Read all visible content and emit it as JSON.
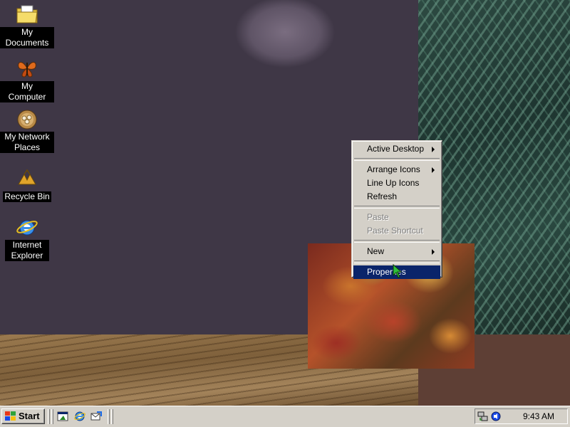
{
  "desktop": {
    "icons": [
      {
        "label": "My Documents",
        "icon": "folder-documents-icon"
      },
      {
        "label": "My Computer",
        "icon": "my-computer-butterfly-icon"
      },
      {
        "label": "My Network Places",
        "icon": "network-places-icon"
      },
      {
        "label": "Recycle Bin",
        "icon": "recycle-bin-icon"
      },
      {
        "label": "Internet Explorer",
        "icon": "internet-explorer-icon"
      }
    ]
  },
  "context_menu": {
    "items": [
      {
        "label": "Active Desktop",
        "submenu": true,
        "enabled": true
      },
      {
        "label": "Arrange Icons",
        "submenu": true,
        "enabled": true
      },
      {
        "label": "Line Up Icons",
        "submenu": false,
        "enabled": true
      },
      {
        "label": "Refresh",
        "submenu": false,
        "enabled": true
      },
      {
        "label": "Paste",
        "submenu": false,
        "enabled": false
      },
      {
        "label": "Paste Shortcut",
        "submenu": false,
        "enabled": false
      },
      {
        "label": "New",
        "submenu": true,
        "enabled": true
      },
      {
        "label": "Properties",
        "submenu": false,
        "enabled": true,
        "highlighted": true
      }
    ]
  },
  "taskbar": {
    "start_label": "Start",
    "quick_launch": [
      "show-desktop-icon",
      "internet-explorer-icon",
      "outlook-express-icon"
    ],
    "tray": {
      "icons": [
        "network-tray-icon",
        "volume-tray-icon"
      ],
      "clock": "9:43 AM"
    }
  },
  "colors": {
    "menu_highlight": "#0a246a",
    "chrome": "#d4d0c8",
    "label_bg": "#000000"
  }
}
